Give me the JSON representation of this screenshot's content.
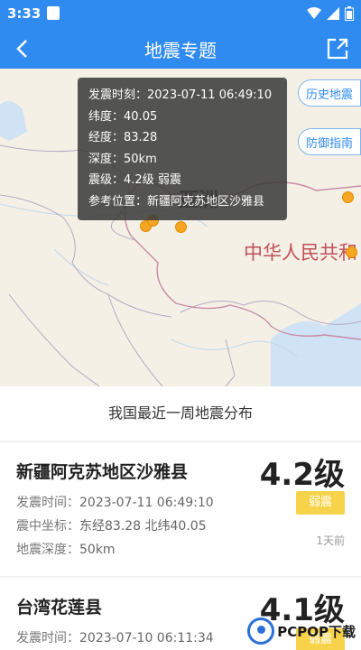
{
  "status": {
    "time": "3:33"
  },
  "app_bar": {
    "title": "地震专题"
  },
  "map": {
    "label_asia": "亚洲",
    "label_china": "中华人民共和",
    "side_buttons": [
      "历史地震",
      "防御指南"
    ],
    "tooltip": {
      "time_label": "发震时刻：",
      "time": "2023-07-11 06:49:10",
      "lat_label": "纬度：",
      "lat": "40.05",
      "lon_label": "经度：",
      "lon": "83.28",
      "depth_label": "深度：",
      "depth": "50km",
      "mag_label": "震级：",
      "mag": "4.2级 弱震",
      "ref_label": "参考位置：",
      "ref": "新疆阿克苏地区沙雅县"
    }
  },
  "section_title": "我国最近一周地震分布",
  "cards": [
    {
      "place": "新疆阿克苏地区沙雅县",
      "time_label": "发震时间：",
      "time": "2023-07-11 06:49:10",
      "coord_label": "震中坐标：",
      "coord": "东经83.28 北纬40.05",
      "depth_label": "地震深度：",
      "depth": "50km",
      "magnitude": "4.2级",
      "badge": "弱震",
      "ago": "1天前"
    },
    {
      "place": "台湾花莲县",
      "time_label": "发震时间：",
      "time": "2023-07-10 06:11:34",
      "magnitude": "4.1级",
      "badge": "弱震"
    }
  ],
  "watermark": "PCPOP下载",
  "colors": {
    "primary": "#2f8bf0",
    "badge": "#f7d34a",
    "dot": "#f5a623",
    "china_label": "#c0505a"
  }
}
